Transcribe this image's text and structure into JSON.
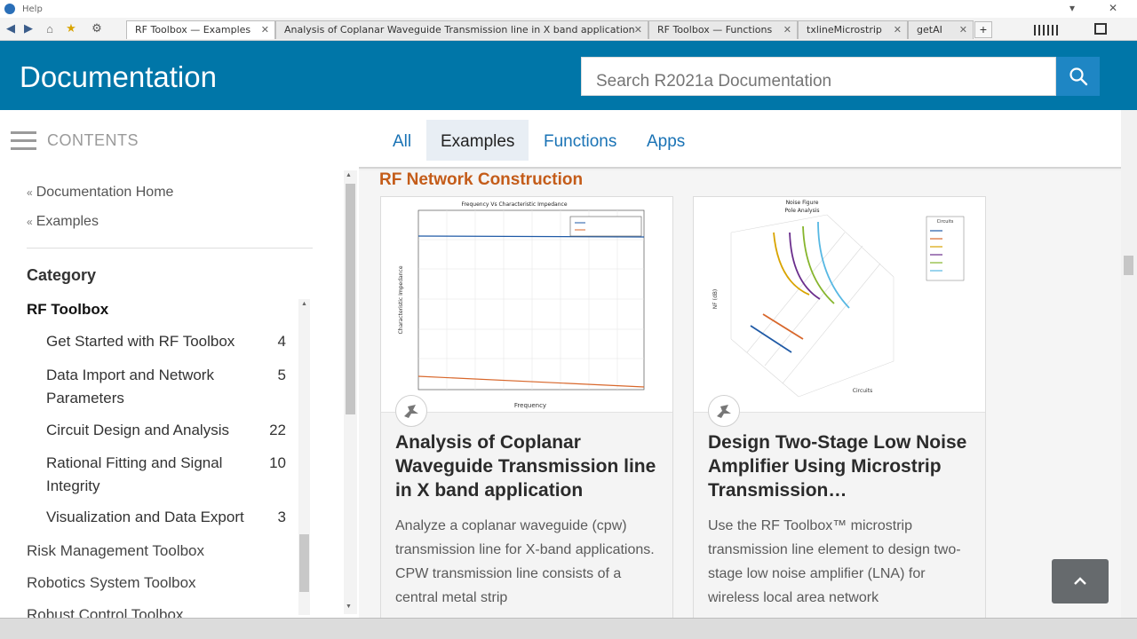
{
  "window": {
    "title": "Help",
    "minimize_glyph": "▾",
    "close_glyph": "✕"
  },
  "toolbar": {
    "icons": [
      "back-arrow-icon",
      "forward-arrow-icon",
      "home-icon",
      "favorites-star-icon",
      "settings-gear-icon"
    ],
    "tabs": [
      {
        "label": "RF Toolbox — Examples",
        "active": true
      },
      {
        "label": "Analysis of Coplanar Waveguide Transmission line in X band application",
        "active": false
      },
      {
        "label": "RF Toolbox — Functions",
        "active": false
      },
      {
        "label": "txlineMicrostrip",
        "active": false
      },
      {
        "label": "getAI",
        "active": false
      }
    ],
    "new_tab_label": "+"
  },
  "header": {
    "title": "Documentation",
    "search_placeholder": "Search R2021a Documentation",
    "search_icon": "search-icon"
  },
  "sidebar": {
    "contents_label": "CONTENTS",
    "links": [
      "Documentation Home",
      "Examples"
    ],
    "category_title": "Category",
    "group": "RF Toolbox",
    "items": [
      {
        "label": "Get Started with RF Toolbox",
        "count": "4"
      },
      {
        "label": "Data Import and Network Parameters",
        "count": "5"
      },
      {
        "label": "Circuit Design and Analysis",
        "count": "22"
      },
      {
        "label": "Rational Fitting and Signal Integrity",
        "count": "10"
      },
      {
        "label": "Visualization and Data Export",
        "count": "3"
      }
    ],
    "toolboxes": [
      "Risk Management Toolbox",
      "Robotics System Toolbox",
      "Robust Control Toolbox"
    ]
  },
  "filters": {
    "tabs": [
      {
        "label": "All",
        "active": false
      },
      {
        "label": "Examples",
        "active": true
      },
      {
        "label": "Functions",
        "active": false
      },
      {
        "label": "Apps",
        "active": false
      }
    ]
  },
  "main": {
    "section_title": "RF Network Construction",
    "cards": [
      {
        "title": "Analysis of Coplanar Waveguide Transmission line in X band application",
        "description": "Analyze a coplanar waveguide (cpw) transmission line for X-band applications. CPW transmission line consists of a central metal strip",
        "thumbnail": "line-plot-thumbnail",
        "plot_title": "Frequency Vs Characteristic Impedance",
        "plot_xlabel": "Frequency",
        "plot_ylabel": "Characteristic Impedance"
      },
      {
        "title": "Design Two-Stage Low Noise Amplifier Using Microstrip Transmission…",
        "description": "Use the RF Toolbox™ microstrip transmission line element to design two-stage low noise amplifier (LNA) for wireless local area network",
        "thumbnail": "3d-plot-thumbnail",
        "plot_title": "Noise Figure",
        "plot_subtitle": "Pole Analysis",
        "plot_legend_title": "Circuits",
        "plot_xlabel": "Circuits",
        "plot_ylabel": "NF (dB)"
      }
    ]
  },
  "back_to_top_icon": "chevron-up-icon"
}
